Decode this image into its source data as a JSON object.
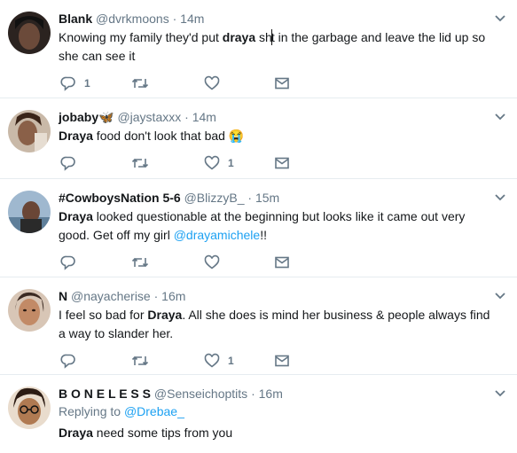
{
  "tweets": [
    {
      "name": "Blank",
      "handle": "@dvrkmoons",
      "time": "14m",
      "text_before": "Knowing my family they'd put ",
      "bold": "draya",
      "text_after_pre": " sh",
      "text_after_post": "t in the garbage and leave the lid up so she can see it",
      "reply_count": "1",
      "like_count": ""
    },
    {
      "name": "jobaby🦋",
      "handle": "@jaystaxxx",
      "time": "14m",
      "bold": "Draya",
      "text_after": " food don't look that bad 😭",
      "reply_count": "",
      "like_count": "1"
    },
    {
      "name": "#CowboysNation 5-6",
      "handle": "@BlizzyB_",
      "time": "15m",
      "bold": "Draya",
      "text_after": " looked questionable at the beginning but looks like it came out very good. Get off my girl ",
      "mention": "@drayamichele",
      "text_end": "!!",
      "reply_count": "",
      "like_count": ""
    },
    {
      "name": "N",
      "handle": "@nayacherise",
      "time": "16m",
      "text_before": "I feel so bad for ",
      "bold": "Draya",
      "text_after": ". All she does is mind her business & people always find a way to slander her.",
      "reply_count": "",
      "like_count": "1"
    },
    {
      "name": "B O N E L E S S",
      "handle": "@Senseichoptits",
      "time": "16m",
      "replying_label": "Replying to ",
      "replying_to": "@Drebae_",
      "bold": "Draya",
      "text_after": " need some tips from you"
    }
  ],
  "separator": "·",
  "icons": {
    "reply": "reply-icon",
    "retweet": "retweet-icon",
    "like": "heart-icon",
    "dm": "envelope-icon",
    "caret": "chevron-down-icon"
  },
  "colors": {
    "icon": "#657786",
    "link": "#1da1f2",
    "divider": "#e6ecf0"
  }
}
